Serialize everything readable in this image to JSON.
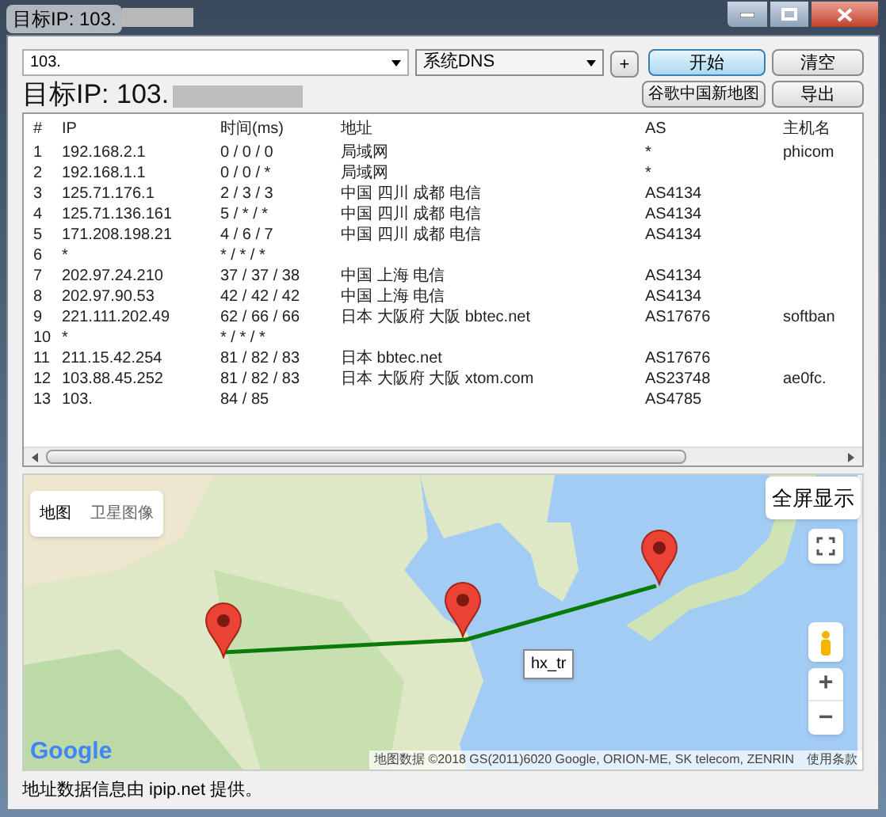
{
  "window": {
    "title": "目标IP: 103."
  },
  "toolbar": {
    "target_input": {
      "value": "103."
    },
    "dns_select": {
      "value": "系统DNS"
    },
    "buttons": [
      {
        "label": "+",
        "focused": false
      },
      {
        "label": "开始",
        "focused": true
      },
      {
        "label": "清空",
        "focused": false
      },
      {
        "label": "谷歌中国新地图",
        "focused": false
      },
      {
        "label": "导出",
        "focused": false
      }
    ]
  },
  "target_label": "目标IP: 103.",
  "table": {
    "columns": [
      "#",
      "IP",
      "时间(ms)",
      "地址",
      "AS",
      "主机名"
    ],
    "rows": [
      [
        "1",
        "192.168.2.1",
        "0 / 0 / 0",
        "局域网",
        "*",
        "phicom"
      ],
      [
        "2",
        "192.168.1.1",
        "0 / 0 / *",
        "局域网",
        "*",
        ""
      ],
      [
        "3",
        "125.71.176.1",
        "2 / 3 / 3",
        "中国 四川 成都 电信",
        "AS4134",
        ""
      ],
      [
        "4",
        "125.71.136.161",
        "5 / * / *",
        "中国 四川 成都 电信",
        "AS4134",
        ""
      ],
      [
        "5",
        "171.208.198.21",
        "4 / 6 / 7",
        "中国 四川 成都 电信",
        "AS4134",
        ""
      ],
      [
        "6",
        "*",
        "* / * / *",
        "",
        "",
        ""
      ],
      [
        "7",
        "202.97.24.210",
        "37 / 37 / 38",
        "中国 上海 电信",
        "AS4134",
        ""
      ],
      [
        "8",
        "202.97.90.53",
        "42 / 42 / 42",
        "中国 上海 电信",
        "AS4134",
        ""
      ],
      [
        "9",
        "221.111.202.49",
        "62 / 66 / 66",
        "日本 大阪府 大阪 bbtec.net",
        "AS17676",
        "softban"
      ],
      [
        "10",
        "*",
        "* / * / *",
        "",
        "",
        ""
      ],
      [
        "11",
        "211.15.42.254",
        "81 / 82 / 83",
        "日本 bbtec.net",
        "AS17676",
        ""
      ],
      [
        "12",
        "103.88.45.252",
        "81 / 82 / 83",
        "日本 大阪府 大阪 xtom.com",
        "AS23748",
        "ae0fc."
      ],
      [
        "13",
        "103.",
        "84 / 85",
        "",
        "AS4785",
        ""
      ]
    ]
  },
  "map": {
    "type_tabs": [
      {
        "label": "地图",
        "selected": true
      },
      {
        "label": "卫星图像",
        "selected": false
      }
    ],
    "fullscreen_button": "全屏显示",
    "zoom_in": "+",
    "zoom_out": "−",
    "tooltip": "hx_tr",
    "logo": "Google",
    "attribution": "地图数据 ©2018 GS(2011)6020 Google, ORION-ME, SK telecom, ZENRIN",
    "terms": "使用条款"
  },
  "footer": "地址数据信息由 ipip.net 提供。"
}
